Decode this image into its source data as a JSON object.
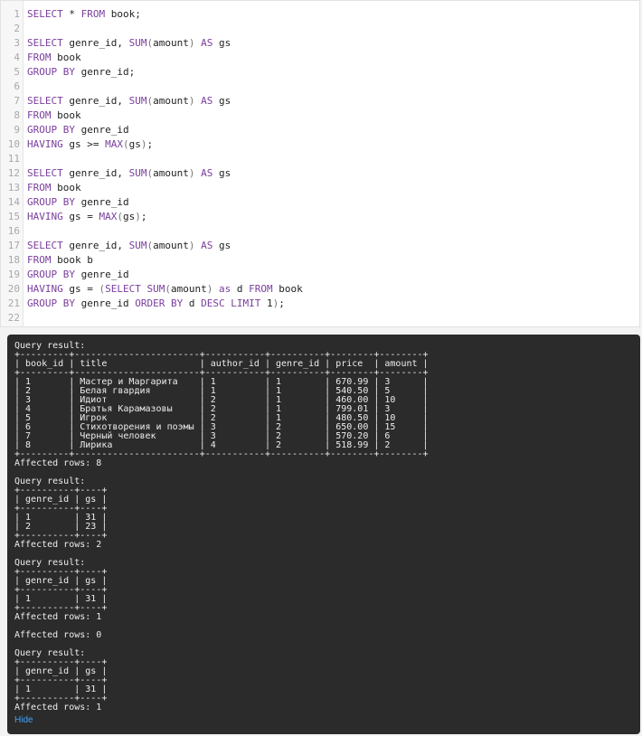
{
  "editor": {
    "lines": [
      {
        "n": "1",
        "tokens": [
          [
            "kw",
            "SELECT"
          ],
          [
            "t",
            " * "
          ],
          [
            "kw",
            "FROM"
          ],
          [
            "t",
            " book;"
          ]
        ]
      },
      {
        "n": "2",
        "tokens": []
      },
      {
        "n": "3",
        "tokens": [
          [
            "kw",
            "SELECT"
          ],
          [
            "t",
            " genre_id, "
          ],
          [
            "fn",
            "SUM"
          ],
          [
            "pn",
            "("
          ],
          [
            "t",
            "amount"
          ],
          [
            "pn",
            ")"
          ],
          [
            "t",
            " "
          ],
          [
            "kw",
            "AS"
          ],
          [
            "t",
            " gs"
          ]
        ]
      },
      {
        "n": "4",
        "tokens": [
          [
            "kw",
            "FROM"
          ],
          [
            "t",
            " book"
          ]
        ]
      },
      {
        "n": "5",
        "tokens": [
          [
            "kw",
            "GROUP BY"
          ],
          [
            "t",
            " genre_id;"
          ]
        ]
      },
      {
        "n": "6",
        "tokens": []
      },
      {
        "n": "7",
        "tokens": [
          [
            "kw",
            "SELECT"
          ],
          [
            "t",
            " genre_id, "
          ],
          [
            "fn",
            "SUM"
          ],
          [
            "pn",
            "("
          ],
          [
            "t",
            "amount"
          ],
          [
            "pn",
            ")"
          ],
          [
            "t",
            " "
          ],
          [
            "kw",
            "AS"
          ],
          [
            "t",
            " gs"
          ]
        ]
      },
      {
        "n": "8",
        "tokens": [
          [
            "kw",
            "FROM"
          ],
          [
            "t",
            " book"
          ]
        ]
      },
      {
        "n": "9",
        "tokens": [
          [
            "kw",
            "GROUP BY"
          ],
          [
            "t",
            " genre_id"
          ]
        ]
      },
      {
        "n": "10",
        "tokens": [
          [
            "kw",
            "HAVING"
          ],
          [
            "t",
            " gs >= "
          ],
          [
            "fn",
            "MAX"
          ],
          [
            "pn",
            "("
          ],
          [
            "t",
            "gs"
          ],
          [
            "pn",
            ")"
          ],
          [
            "t",
            ";"
          ]
        ]
      },
      {
        "n": "11",
        "tokens": []
      },
      {
        "n": "12",
        "tokens": [
          [
            "kw",
            "SELECT"
          ],
          [
            "t",
            " genre_id, "
          ],
          [
            "fn",
            "SUM"
          ],
          [
            "pn",
            "("
          ],
          [
            "t",
            "amount"
          ],
          [
            "pn",
            ")"
          ],
          [
            "t",
            " "
          ],
          [
            "kw",
            "AS"
          ],
          [
            "t",
            " gs"
          ]
        ]
      },
      {
        "n": "13",
        "tokens": [
          [
            "kw",
            "FROM"
          ],
          [
            "t",
            " book"
          ]
        ]
      },
      {
        "n": "14",
        "tokens": [
          [
            "kw",
            "GROUP BY"
          ],
          [
            "t",
            " genre_id"
          ]
        ]
      },
      {
        "n": "15",
        "tokens": [
          [
            "kw",
            "HAVING"
          ],
          [
            "t",
            " gs = "
          ],
          [
            "fn",
            "MAX"
          ],
          [
            "pn",
            "("
          ],
          [
            "t",
            "gs"
          ],
          [
            "pn",
            ")"
          ],
          [
            "t",
            ";"
          ]
        ]
      },
      {
        "n": "16",
        "tokens": []
      },
      {
        "n": "17",
        "tokens": [
          [
            "kw",
            "SELECT"
          ],
          [
            "t",
            " genre_id, "
          ],
          [
            "fn",
            "SUM"
          ],
          [
            "pn",
            "("
          ],
          [
            "t",
            "amount"
          ],
          [
            "pn",
            ")"
          ],
          [
            "t",
            " "
          ],
          [
            "kw",
            "AS"
          ],
          [
            "t",
            " gs"
          ]
        ]
      },
      {
        "n": "18",
        "tokens": [
          [
            "kw",
            "FROM"
          ],
          [
            "t",
            " book b"
          ]
        ]
      },
      {
        "n": "19",
        "tokens": [
          [
            "kw",
            "GROUP BY"
          ],
          [
            "t",
            " genre_id"
          ]
        ]
      },
      {
        "n": "20",
        "tokens": [
          [
            "kw",
            "HAVING"
          ],
          [
            "t",
            " gs = "
          ],
          [
            "pn",
            "("
          ],
          [
            "kw",
            "SELECT"
          ],
          [
            "t",
            " "
          ],
          [
            "fn",
            "SUM"
          ],
          [
            "pn",
            "("
          ],
          [
            "t",
            "amount"
          ],
          [
            "pn",
            ")"
          ],
          [
            "t",
            " "
          ],
          [
            "kw",
            "as"
          ],
          [
            "t",
            " d "
          ],
          [
            "kw",
            "FROM"
          ],
          [
            "t",
            " book"
          ]
        ]
      },
      {
        "n": "21",
        "tokens": [
          [
            "kw",
            "GROUP BY"
          ],
          [
            "t",
            " genre_id "
          ],
          [
            "kw",
            "ORDER BY"
          ],
          [
            "t",
            " d "
          ],
          [
            "kw",
            "DESC"
          ],
          [
            "t",
            " "
          ],
          [
            "kw",
            "LIMIT"
          ],
          [
            "t",
            " 1"
          ],
          [
            "pn",
            ")"
          ],
          [
            "t",
            ";"
          ]
        ]
      },
      {
        "n": "22",
        "tokens": []
      }
    ]
  },
  "console": {
    "lines": [
      "Query result:",
      "+---------+-----------------------+-----------+----------+--------+--------+",
      "| book_id | title                 | author_id | genre_id | price  | amount |",
      "+---------+-----------------------+-----------+----------+--------+--------+",
      "| 1       | Мастер и Маргарита    | 1         | 1        | 670.99 | 3      |",
      "| 2       | Белая гвардия         | 1         | 1        | 540.50 | 5      |",
      "| 3       | Идиот                 | 2         | 1        | 460.00 | 10     |",
      "| 4       | Братья Карамазовы     | 2         | 1        | 799.01 | 3      |",
      "| 5       | Игрок                 | 2         | 1        | 480.50 | 10     |",
      "| 6       | Стихотворения и поэмы | 3         | 2        | 650.00 | 15     |",
      "| 7       | Черный человек        | 3         | 2        | 570.20 | 6      |",
      "| 8       | Лирика                | 4         | 2        | 518.99 | 2      |",
      "+---------+-----------------------+-----------+----------+--------+--------+",
      "Affected rows: 8",
      "",
      "Query result:",
      "+----------+----+",
      "| genre_id | gs |",
      "+----------+----+",
      "| 1        | 31 |",
      "| 2        | 23 |",
      "+----------+----+",
      "Affected rows: 2",
      "",
      "Query result:",
      "+----------+----+",
      "| genre_id | gs |",
      "+----------+----+",
      "| 1        | 31 |",
      "+----------+----+",
      "Affected rows: 1",
      "",
      "Affected rows: 0",
      "",
      "Query result:",
      "+----------+----+",
      "| genre_id | gs |",
      "+----------+----+",
      "| 1        | 31 |",
      "+----------+----+",
      "Affected rows: 1"
    ],
    "hide_label": "Hide"
  },
  "colors": {
    "keyword": "#7a3e9d",
    "console_bg": "#2b2b2b",
    "link": "#3ea4ff"
  }
}
